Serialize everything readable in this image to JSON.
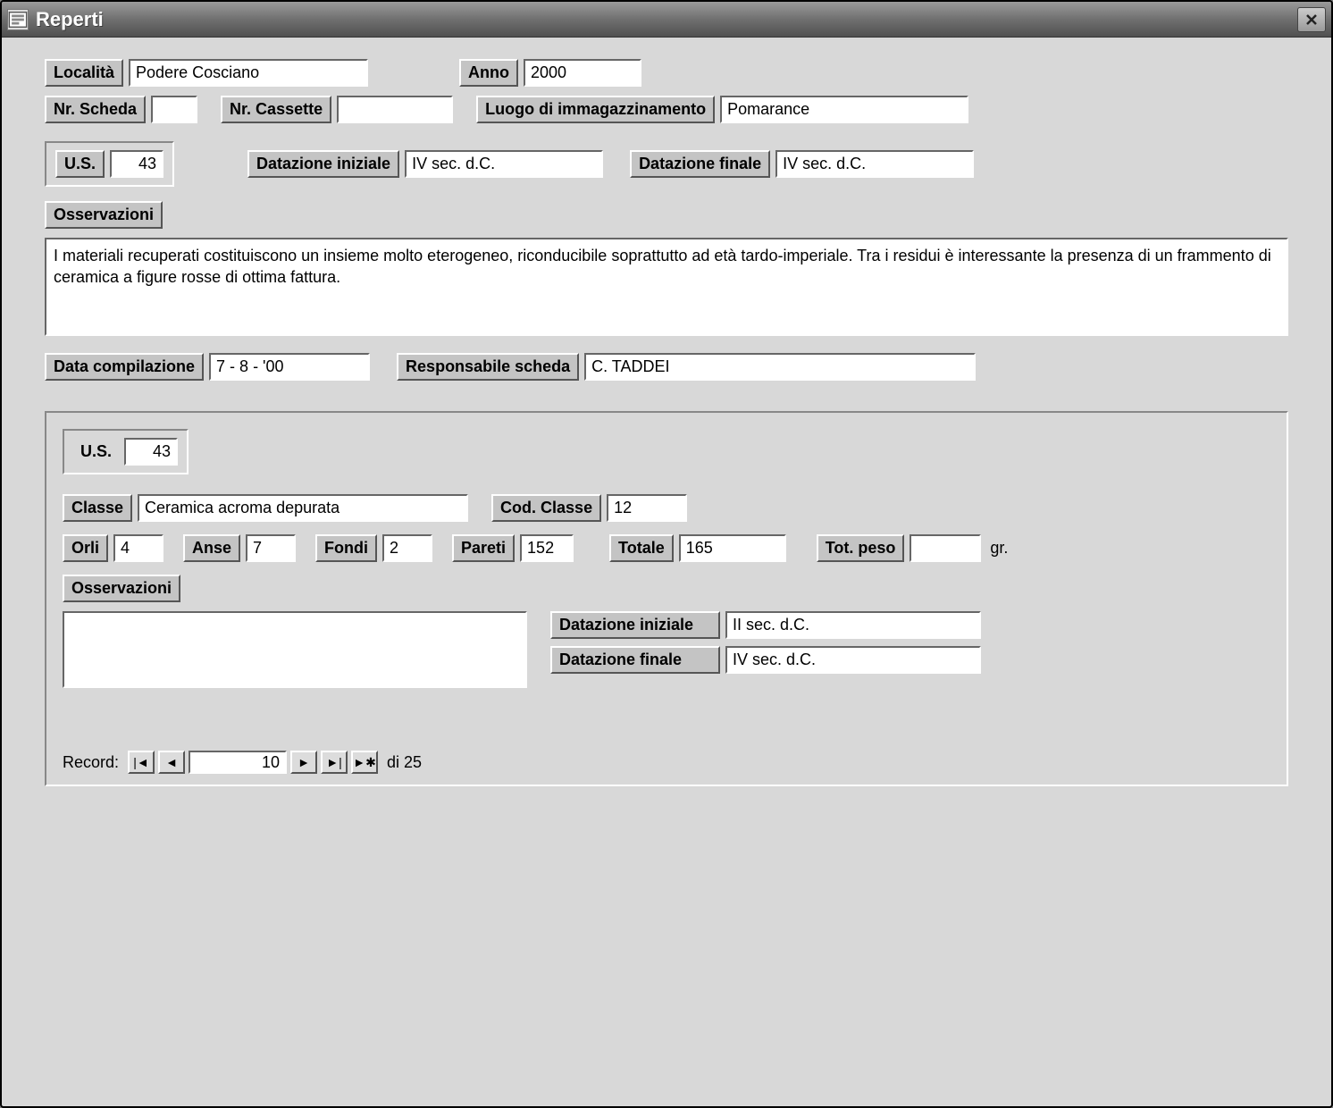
{
  "window": {
    "title": "Reperti"
  },
  "header": {
    "localita_label": "Località",
    "localita_value": "Podere Cosciano",
    "anno_label": "Anno",
    "anno_value": "2000",
    "nr_scheda_label": "Nr. Scheda",
    "nr_scheda_value": "",
    "nr_cassette_label": "Nr. Cassette",
    "nr_cassette_value": "",
    "luogo_label": "Luogo di immagazzinamento",
    "luogo_value": "Pomarance"
  },
  "us_block": {
    "us_label": "U.S.",
    "us_value": "43",
    "dat_iniz_label": "Datazione iniziale",
    "dat_iniz_value": "IV sec. d.C.",
    "dat_fin_label": "Datazione finale",
    "dat_fin_value": "IV sec. d.C."
  },
  "osservazioni": {
    "label": "Osservazioni",
    "value": "I materiali recuperati costituiscono un insieme molto eterogeneo, riconducibile soprattutto ad età tardo-imperiale. Tra i residui è interessante la presenza di un frammento di ceramica a figure rosse di ottima fattura."
  },
  "footer_upper": {
    "data_comp_label": "Data compilazione",
    "data_comp_value": "7 - 8 - '00",
    "resp_label": "Responsabile scheda",
    "resp_value": "C. TADDEI"
  },
  "subform": {
    "us_label": "U.S.",
    "us_value": "43",
    "classe_label": "Classe",
    "classe_value": "Ceramica acroma depurata",
    "cod_classe_label": "Cod. Classe",
    "cod_classe_value": "12",
    "orli_label": "Orli",
    "orli_value": "4",
    "anse_label": "Anse",
    "anse_value": "7",
    "fondi_label": "Fondi",
    "fondi_value": "2",
    "pareti_label": "Pareti",
    "pareti_value": "152",
    "totale_label": "Totale",
    "totale_value": "165",
    "tot_peso_label": "Tot. peso",
    "tot_peso_value": "",
    "tot_peso_suffix": "gr.",
    "osservazioni_label": "Osservazioni",
    "osservazioni_value": "",
    "dat_iniz_label": "Datazione iniziale",
    "dat_iniz_value": "II sec. d.C.",
    "dat_fin_label": "Datazione finale",
    "dat_fin_value": "IV sec. d.C."
  },
  "record_nav": {
    "label": "Record:",
    "current": "10",
    "of_text": "di 25"
  }
}
